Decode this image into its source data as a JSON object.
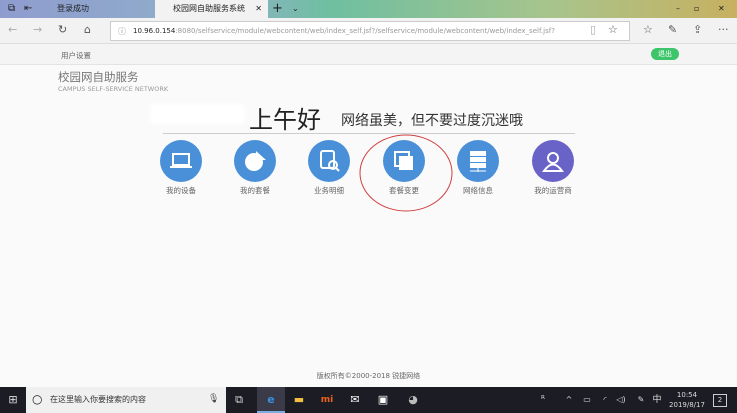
{
  "browser": {
    "tabs": [
      {
        "label": "登录成功"
      },
      {
        "label": "校园网自助服务系统"
      }
    ],
    "url_host": "10.96.0.154",
    "url_rest": ":8080/selfservice/module/webcontent/web/index_self.jsf?/selfservice/module/webcontent/web/index_self.jsf?"
  },
  "header": {
    "user_settings": "用户设置",
    "logout": "退出",
    "brand_cn": "校园网自助服务",
    "brand_en": "CAMPUS  SELF-SERVICE NETWORK"
  },
  "greeting": {
    "title": "上午好",
    "subtitle": "网络虽美，但不要过度沉迷哦"
  },
  "menu": [
    {
      "label": "我的设备"
    },
    {
      "label": "我的套餐"
    },
    {
      "label": "业务明细"
    },
    {
      "label": "套餐变更"
    },
    {
      "label": "网络信息"
    },
    {
      "label": "我的运营商"
    }
  ],
  "footer": "版权所有©2000-2018 锐捷网络",
  "taskbar": {
    "search_placeholder": "在这里输入你要搜索的内容",
    "time": "10:54",
    "date": "2019/8/17",
    "ime": "中",
    "notifications": "2"
  }
}
